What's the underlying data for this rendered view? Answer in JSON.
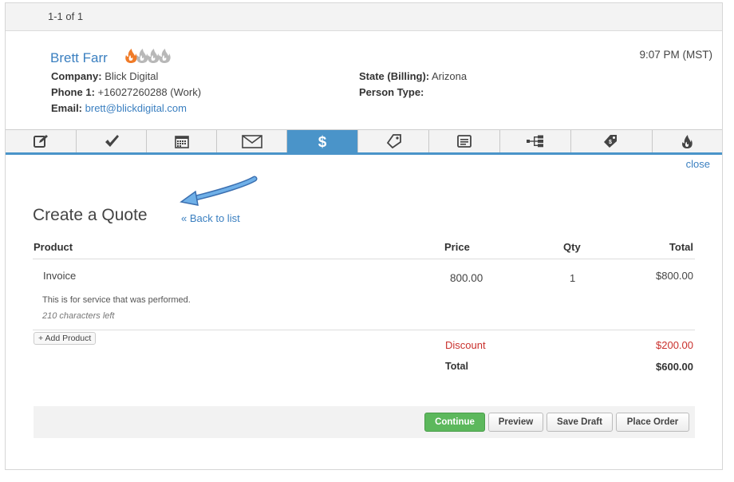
{
  "pager": {
    "text": "1-1 of 1"
  },
  "contact": {
    "name": "Brett Farr",
    "time": "9:07 PM (MST)",
    "company_label": "Company:",
    "company": "Blick Digital",
    "phone_label": "Phone 1:",
    "phone": "+16027260288 (Work)",
    "email_label": "Email:",
    "email": "brett@blickdigital.com",
    "state_label": "State (Billing):",
    "state": "Arizona",
    "person_type_label": "Person Type:",
    "person_type": "",
    "lead_score": 1
  },
  "tabs": [
    {
      "icon": "edit-icon"
    },
    {
      "icon": "checkmark-icon"
    },
    {
      "icon": "calendar-icon"
    },
    {
      "icon": "envelope-icon"
    },
    {
      "icon": "dollar-icon",
      "active": true
    },
    {
      "icon": "tag-icon"
    },
    {
      "icon": "document-icon"
    },
    {
      "icon": "sitemap-icon"
    },
    {
      "icon": "tags-icon"
    },
    {
      "icon": "flame-icon"
    }
  ],
  "panel": {
    "close": "close",
    "title": "Create a Quote",
    "back": "« Back to list"
  },
  "table": {
    "headers": {
      "product": "Product",
      "price": "Price",
      "qty": "Qty",
      "total": "Total"
    },
    "rows": [
      {
        "product": "Invoice",
        "price": "800.00",
        "qty": "1",
        "total": "$800.00",
        "description": "This is for service that was performed.",
        "chars_left": "210 characters left"
      }
    ],
    "add_product": "+ Add Product",
    "discount_label": "Discount",
    "discount_value": "$200.00",
    "total_label": "Total",
    "total_value": "$600.00"
  },
  "actions": {
    "continue": "Continue",
    "preview": "Preview",
    "save_draft": "Save Draft",
    "place_order": "Place Order"
  },
  "colors": {
    "accent": "#4a94c9",
    "link": "#3a7fc0",
    "discount": "#c9302c",
    "continue": "#5cb85c",
    "flame_active": "#f07b28",
    "flame_inactive": "#b8b8b8"
  }
}
